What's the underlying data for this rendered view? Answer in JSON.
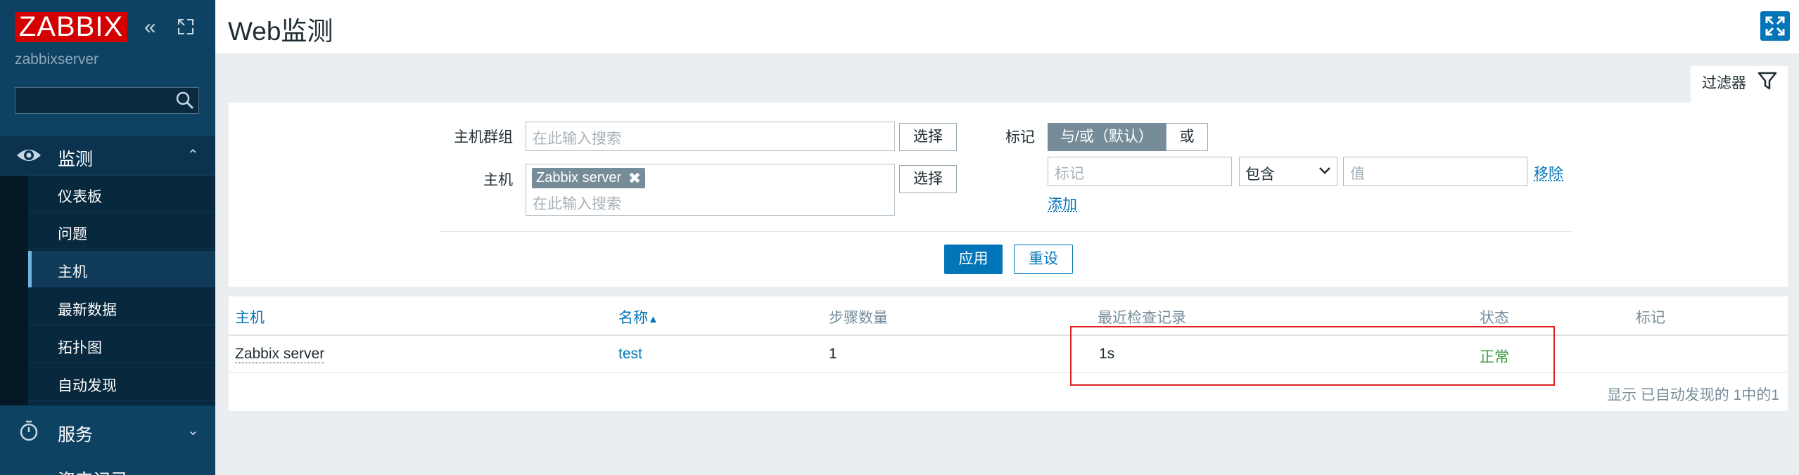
{
  "sidebar": {
    "logo": "ZABBIX",
    "server_name": "zabbixserver",
    "search": {
      "value": "",
      "placeholder": ""
    },
    "sections": [
      {
        "label": "监测",
        "expanded": true
      },
      {
        "label": "服务",
        "expanded": false
      },
      {
        "label": "资产记录",
        "expanded": false
      }
    ],
    "monitor_items": [
      {
        "label": "仪表板"
      },
      {
        "label": "问题"
      },
      {
        "label": "主机",
        "active": true
      },
      {
        "label": "最新数据"
      },
      {
        "label": "拓扑图"
      },
      {
        "label": "自动发现"
      }
    ]
  },
  "header": {
    "title": "Web监测"
  },
  "filter": {
    "tab_label": "过滤器",
    "host_group": {
      "label": "主机群组",
      "placeholder": "在此输入搜索",
      "select_button": "选择"
    },
    "host": {
      "label": "主机",
      "selected_tag": "Zabbix server",
      "placeholder": "在此输入搜索",
      "select_button": "选择"
    },
    "tags": {
      "label": "标记",
      "and_or_option": "与/或（默认）",
      "or_option": "或",
      "tag_placeholder": "标记",
      "operator_value": "包含",
      "value_placeholder": "值",
      "remove_link": "移除",
      "add_link": "添加"
    },
    "apply_button": "应用",
    "reset_button": "重设"
  },
  "table": {
    "columns": [
      "主机",
      "名称",
      "步骤数量",
      "最近检查记录",
      "状态",
      "标记"
    ],
    "sort_indicator": "▲",
    "rows": [
      {
        "host": "Zabbix server",
        "name": "test",
        "steps": "1",
        "last_check": "1s",
        "status": "正常",
        "tags": ""
      }
    ],
    "footer": "显示 已自动发现的 1中的1"
  },
  "colors": {
    "sidebar_bg": "#0e4262",
    "logo_red": "#d40000",
    "accent_blue": "#0275b8",
    "status_ok": "#429e47",
    "highlight_red": "#e0201e"
  }
}
